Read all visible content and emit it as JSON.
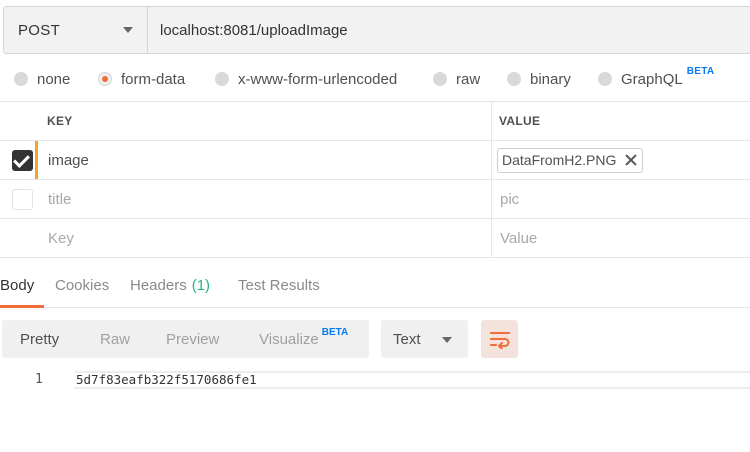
{
  "request": {
    "method": "POST",
    "url": "localhost:8081/uploadImage"
  },
  "body_types": [
    {
      "label": "none",
      "selected": false
    },
    {
      "label": "form-data",
      "selected": true
    },
    {
      "label": "x-www-form-urlencoded",
      "selected": false
    },
    {
      "label": "raw",
      "selected": false
    },
    {
      "label": "binary",
      "selected": false
    },
    {
      "label": "GraphQL",
      "selected": false,
      "badge": "BETA"
    }
  ],
  "params_table": {
    "headers": {
      "key": "KEY",
      "value": "VALUE"
    },
    "rows": [
      {
        "checked": true,
        "key": "image",
        "value_file": "DataFromH2.PNG"
      },
      {
        "checked": false,
        "key": "title",
        "value": "pic"
      }
    ],
    "placeholder": {
      "key": "Key",
      "value": "Value"
    }
  },
  "response_tabs": [
    {
      "label": "Body",
      "active": true
    },
    {
      "label": "Cookies",
      "active": false
    },
    {
      "label": "Headers",
      "count": "(1)",
      "active": false
    },
    {
      "label": "Test Results",
      "active": false
    }
  ],
  "view_modes": [
    {
      "label": "Pretty",
      "active": true
    },
    {
      "label": "Raw",
      "active": false
    },
    {
      "label": "Preview",
      "active": false
    },
    {
      "label": "Visualize",
      "badge": "BETA",
      "active": false
    }
  ],
  "format": {
    "selected": "Text"
  },
  "icons": {
    "wrap": "wrap-lines-icon",
    "remove_file": "close-icon",
    "dropdown": "chevron-down-icon"
  },
  "colors": {
    "accent": "#f26b3a",
    "beta": "#097bed",
    "count": "#26b47f",
    "row_marker": "#f5a623"
  },
  "response_body": {
    "lines": [
      {
        "number": "1",
        "text": "5d7f83eafb322f5170686fe1"
      }
    ]
  }
}
